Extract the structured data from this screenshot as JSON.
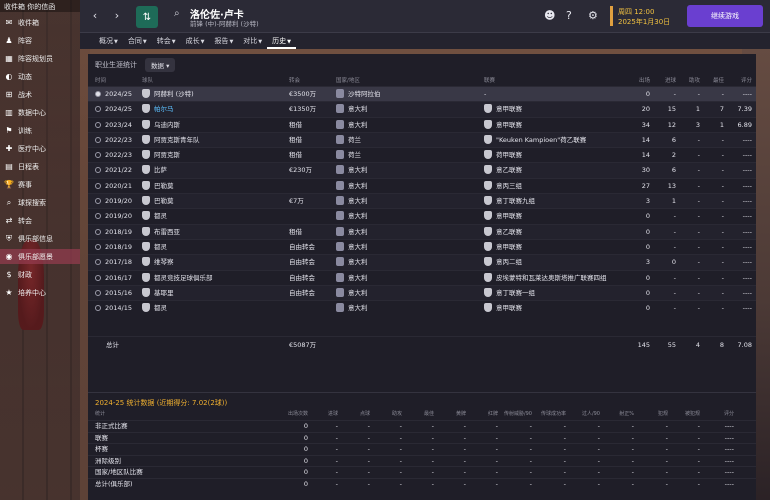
{
  "sidebar": {
    "top_label": "收件箱 你的信函",
    "items": [
      {
        "icon": "inbox-icon",
        "label": "收件箱"
      },
      {
        "icon": "squad-icon",
        "label": "阵容"
      },
      {
        "icon": "planner-icon",
        "label": "阵容规划员"
      },
      {
        "icon": "dynamics-icon",
        "label": "动态"
      },
      {
        "icon": "tactics-icon",
        "label": "战术"
      },
      {
        "icon": "data-hub-icon",
        "label": "数据中心"
      },
      {
        "icon": "training-icon",
        "label": "训练"
      },
      {
        "icon": "medical-icon",
        "label": "医疗中心"
      },
      {
        "icon": "schedule-icon",
        "label": "日程表"
      },
      {
        "icon": "trophy-icon",
        "label": "赛事"
      },
      {
        "icon": "scouting-icon",
        "label": "球探搜索"
      },
      {
        "icon": "transfer-icon",
        "label": "转会"
      },
      {
        "icon": "club-info-icon",
        "label": "俱乐部信息"
      },
      {
        "icon": "vision-icon",
        "label": "俱乐部愿景"
      },
      {
        "icon": "finance-icon",
        "label": "财政"
      },
      {
        "icon": "dev-centre-icon",
        "label": "培养中心"
      }
    ]
  },
  "header": {
    "player_name": "洛伦佐·卢卡",
    "player_sub": "前锋 (中)-阿赫利 (沙特)",
    "date_line1": "周四 12:00",
    "date_line2": "2025年1月30日",
    "continue_label": "继续游戏"
  },
  "tabs": [
    {
      "label": "概况",
      "chev": true
    },
    {
      "label": "合同",
      "chev": true
    },
    {
      "label": "转会",
      "chev": true
    },
    {
      "label": "成长",
      "chev": true
    },
    {
      "label": "报告",
      "chev": true
    },
    {
      "label": "对比",
      "chev": true
    },
    {
      "label": "历史",
      "chev": true,
      "active": true
    }
  ],
  "panel": {
    "title": "职业生涯统计",
    "data_button": "数据",
    "columns": {
      "season": "时间",
      "club": "球队",
      "fee": "转会",
      "nation": "国家/地区",
      "league": "联赛",
      "apps": "出场",
      "goals": "进球",
      "assists": "助攻",
      "pom": "最佳",
      "rating": "评分"
    }
  },
  "career_rows": [
    {
      "season": "2024/25",
      "club": "阿赫利 (沙特)",
      "fee": "€3500万",
      "nation": "沙特阿拉伯",
      "league": "-",
      "apps": "0",
      "goals": "-",
      "assists": "-",
      "pom": "-",
      "rating": "----",
      "selected": true,
      "link": false
    },
    {
      "season": "2024/25",
      "club": "帕尔马",
      "fee": "€1350万",
      "nation": "意大利",
      "league": "意甲联赛",
      "apps": "20",
      "goals": "15",
      "assists": "1",
      "pom": "7",
      "rating": "7.39",
      "link": true
    },
    {
      "season": "2023/24",
      "club": "乌迪内斯",
      "fee": "租借",
      "nation": "意大利",
      "league": "意甲联赛",
      "apps": "34",
      "goals": "12",
      "assists": "3",
      "pom": "1",
      "rating": "6.89"
    },
    {
      "season": "2022/23",
      "club": "阿贾克斯青年队",
      "fee": "租借",
      "nation": "荷兰",
      "league": "\"Keuken Kampioen\"荷乙联赛",
      "apps": "14",
      "goals": "6",
      "assists": "-",
      "pom": "-",
      "rating": "----"
    },
    {
      "season": "2022/23",
      "club": "阿贾克斯",
      "fee": "租借",
      "nation": "荷兰",
      "league": "荷甲联赛",
      "apps": "14",
      "goals": "2",
      "assists": "-",
      "pom": "-",
      "rating": "----"
    },
    {
      "season": "2021/22",
      "club": "比萨",
      "fee": "€230万",
      "nation": "意大利",
      "league": "意乙联赛",
      "apps": "30",
      "goals": "6",
      "assists": "-",
      "pom": "-",
      "rating": "----"
    },
    {
      "season": "2020/21",
      "club": "巴勒莫",
      "fee": "",
      "nation": "意大利",
      "league": "意丙三组",
      "apps": "27",
      "goals": "13",
      "assists": "-",
      "pom": "-",
      "rating": "----"
    },
    {
      "season": "2019/20",
      "club": "巴勒莫",
      "fee": "€7万",
      "nation": "意大利",
      "league": "意丁联赛九组",
      "apps": "3",
      "goals": "1",
      "assists": "-",
      "pom": "-",
      "rating": "----"
    },
    {
      "season": "2019/20",
      "club": "都灵",
      "fee": "",
      "nation": "意大利",
      "league": "意甲联赛",
      "apps": "0",
      "goals": "-",
      "assists": "-",
      "pom": "-",
      "rating": "----"
    },
    {
      "season": "2018/19",
      "club": "布雷西亚",
      "fee": "租借",
      "nation": "意大利",
      "league": "意乙联赛",
      "apps": "0",
      "goals": "-",
      "assists": "-",
      "pom": "-",
      "rating": "----"
    },
    {
      "season": "2018/19",
      "club": "都灵",
      "fee": "自由转会",
      "nation": "意大利",
      "league": "意甲联赛",
      "apps": "0",
      "goals": "-",
      "assists": "-",
      "pom": "-",
      "rating": "----"
    },
    {
      "season": "2017/18",
      "club": "维琴察",
      "fee": "自由转会",
      "nation": "意大利",
      "league": "意丙二组",
      "apps": "3",
      "goals": "0",
      "assists": "-",
      "pom": "-",
      "rating": "----"
    },
    {
      "season": "2016/17",
      "club": "都灵竞技足球俱乐部",
      "fee": "自由转会",
      "nation": "意大利",
      "league": "皮埃蒙特和瓦莱达奥斯塔推广联赛四组",
      "apps": "0",
      "goals": "-",
      "assists": "-",
      "pom": "-",
      "rating": "----"
    },
    {
      "season": "2015/16",
      "club": "基耶里",
      "fee": "自由转会",
      "nation": "意大利",
      "league": "意丁联赛一组",
      "apps": "0",
      "goals": "-",
      "assists": "-",
      "pom": "-",
      "rating": "----"
    },
    {
      "season": "2014/15",
      "club": "都灵",
      "fee": "",
      "nation": "意大利",
      "league": "意甲联赛",
      "apps": "0",
      "goals": "-",
      "assists": "-",
      "pom": "-",
      "rating": "----"
    }
  ],
  "totals": {
    "label": "总计",
    "fee": "€5087万",
    "apps": "145",
    "goals": "55",
    "assists": "4",
    "pom": "8",
    "rating": "7.08"
  },
  "stats": {
    "title": "2024-25 统计数据 (近期得分: 7.02(2球))",
    "columns": [
      "统计",
      "出场次数",
      "进球",
      "点球",
      "助攻",
      "最佳",
      "黄牌",
      "红牌",
      "传射威胁/90",
      "传球成功率",
      "过人/90",
      "射正%",
      "犯规",
      "被犯规",
      "评分"
    ],
    "rows": [
      {
        "label": "非正式比赛",
        "apps": "0"
      },
      {
        "label": "联赛",
        "apps": "0"
      },
      {
        "label": "杯赛",
        "apps": "0"
      },
      {
        "label": "洲际级别",
        "apps": "0"
      },
      {
        "label": "国家/地区队比赛",
        "apps": "0"
      },
      {
        "label": "总计(俱乐部)",
        "apps": "0"
      }
    ],
    "dash": "-",
    "rating_dash": "----"
  }
}
